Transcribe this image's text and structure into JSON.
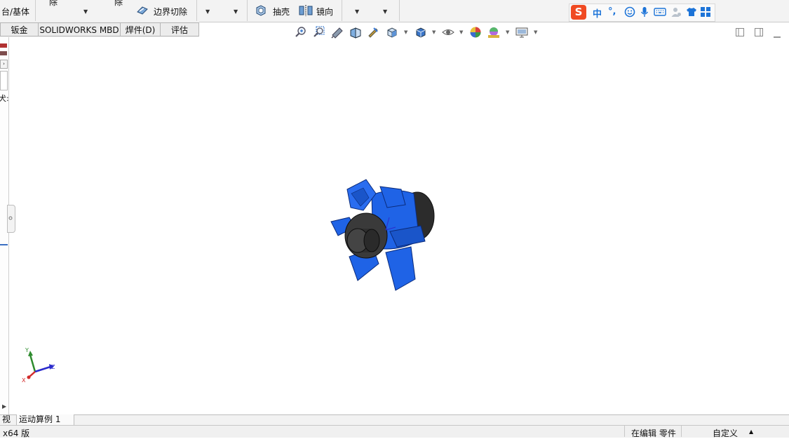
{
  "ribbon": {
    "base_boss_label": "台/基体",
    "cut_label_1": "除",
    "cut_label_2": "除",
    "boundary_cut_label": "边界切除",
    "shell_label": "抽壳",
    "mirror_label": "镜向"
  },
  "ime": {
    "logo_letter": "S",
    "mode_label": "中",
    "punct_label": "°,"
  },
  "tabs": [
    {
      "label": "钣金"
    },
    {
      "label": "SOLIDWORKS MBD"
    },
    {
      "label": "焊件(D)"
    },
    {
      "label": "评估"
    }
  ],
  "left_panel": {
    "cut_text": "犬:"
  },
  "triad": {
    "x_label": "X",
    "y_label": "Y",
    "z_label": "Z"
  },
  "bottom_tabs": [
    {
      "label": "视图"
    },
    {
      "label": "运动算例 1"
    }
  ],
  "status": {
    "left_text": "x64 版",
    "editing_text": "在编辑 零件",
    "custom_text": "自定义"
  },
  "colors": {
    "part_blue": "#1f63e6",
    "part_dark": "#2c2c2c",
    "triad_x": "#d22b2b",
    "triad_y": "#2e8b2e",
    "triad_z": "#2b2bcc"
  }
}
